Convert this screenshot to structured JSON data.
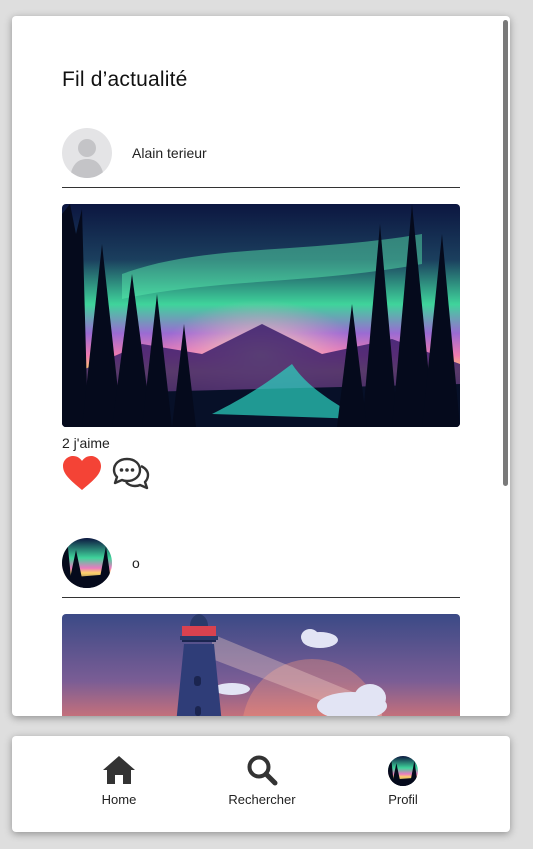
{
  "feed": {
    "title": "Fil d’actualité"
  },
  "posts": [
    {
      "author": "Alain terieur",
      "likes": "2 j'aime",
      "avatar_icon": "user-placeholder-icon",
      "image": "aurora-forest-illustration",
      "like_icon": "heart-icon",
      "comment_icon": "comment-bubbles-icon"
    },
    {
      "author": "o",
      "avatar_icon": "aurora-forest-avatar",
      "image": "lighthouse-sunset-illustration"
    }
  ],
  "nav": {
    "home_label": "Home",
    "search_label": "Rechercher",
    "profile_label": "Profil",
    "home_icon": "home-icon",
    "search_icon": "search-icon",
    "profile_icon": "profile-avatar"
  },
  "colors": {
    "heart": "#f44336",
    "background": "#dedede",
    "card": "#ffffff"
  }
}
